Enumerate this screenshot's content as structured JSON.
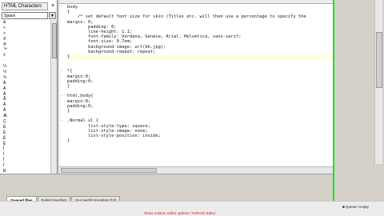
{
  "left_panel": {
    "title": "HTML Characters",
    "close_glyph": "×",
    "selected": "Space",
    "chars": [
      "&",
      "<",
      ">",
      "©",
      "®",
      "™",
      "±",
      "·",
      "¼",
      "½",
      "¾",
      "À",
      "Á",
      "Â",
      "Ã",
      "Ä",
      "Å",
      "Æ",
      "Ç",
      "È",
      "É",
      "Ê",
      "Ë",
      "Ì",
      "Í",
      "Î",
      "Ï",
      "Ð",
      "Ñ",
      "Ò"
    ]
  },
  "editor": {
    "tabs": [
      "",
      "",
      ""
    ],
    "lines": [
      "body",
      "{",
      "    /* set default font size for skin (Titles etc. will then use a percentage to specify the",
      "margin: 0;",
      "        padding: 0;",
      "        line-height: 1.1;",
      "        font-family: Verdana, Geneva, Arial, Helvetica, sans-serif;",
      "        font-size: 0.7em;",
      "        background-image: url(bk.jpg);",
      "        background-repeat: repeat;",
      "}",
      "",
      "",
      "*{",
      "margin:0;",
      "padding:0;",
      "}",
      "",
      "html,body{",
      "margin:0;",
      "padding:0;",
      "}",
      "",
      ".Normal ul {",
      "        list-style-type: square;",
      "        list-style-image: none;",
      "        list-style-position: inside;",
      "}"
    ]
  },
  "bottom": {
    "tabs": [
      "Queued files",
      "Failed transfers",
      "Successful transfers (10)"
    ],
    "caption": "Show custom editor options / Refresh Editor",
    "status": "■ Queue: empty"
  }
}
